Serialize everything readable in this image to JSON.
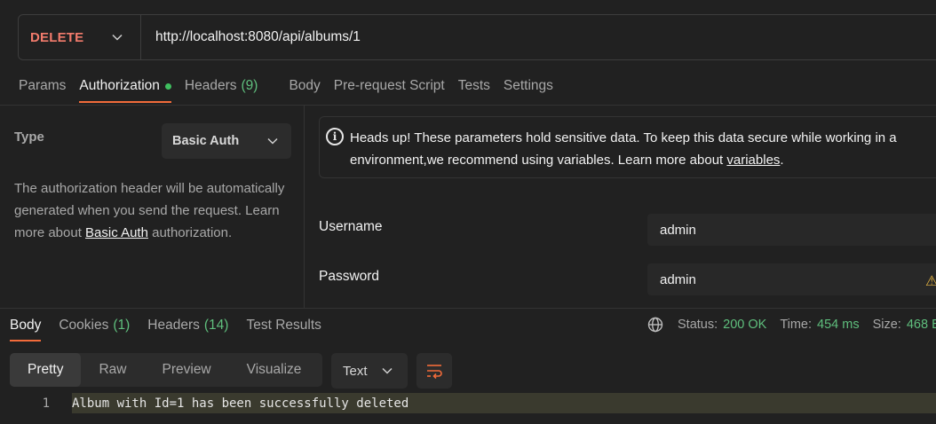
{
  "request": {
    "method": "DELETE",
    "url": "http://localhost:8080/api/albums/1"
  },
  "request_tabs": [
    {
      "label": "Params"
    },
    {
      "label": "Authorization"
    },
    {
      "label": "Headers",
      "count": "(9)"
    },
    {
      "label": "Body"
    },
    {
      "label": "Pre-request Script"
    },
    {
      "label": "Tests"
    },
    {
      "label": "Settings"
    }
  ],
  "auth": {
    "type_label": "Type",
    "type_value": "Basic Auth",
    "desc_1": "The authorization header will be automatically generated when you send the request. Learn more about ",
    "desc_link": "Basic Auth",
    "desc_2": " authorization.",
    "notice_1": "Heads up! These parameters hold sensitive data. To keep this data secure while working in a",
    "notice_2": "environment,we recommend using variables. Learn more about ",
    "notice_link": "variables",
    "notice_end": ".",
    "username_label": "Username",
    "username_value": "admin",
    "password_label": "Password",
    "password_value": "admin"
  },
  "response_tabs": [
    {
      "label": "Body"
    },
    {
      "label": "Cookies",
      "count": "(1)"
    },
    {
      "label": "Headers",
      "count": "(14)"
    },
    {
      "label": "Test Results"
    }
  ],
  "status": {
    "status_label": "Status:",
    "status_value": "200 OK",
    "time_label": "Time:",
    "time_value": "454 ms",
    "size_label": "Size:",
    "size_value": "468 B"
  },
  "view_modes": [
    "Pretty",
    "Raw",
    "Preview",
    "Visualize"
  ],
  "format": "Text",
  "response_body": {
    "line_number": "1",
    "text": "Album with Id=1 has been successfully deleted"
  },
  "colors": {
    "accent": "#f26b3a",
    "method_delete": "#f27b6c",
    "success": "#5fbf7d"
  }
}
